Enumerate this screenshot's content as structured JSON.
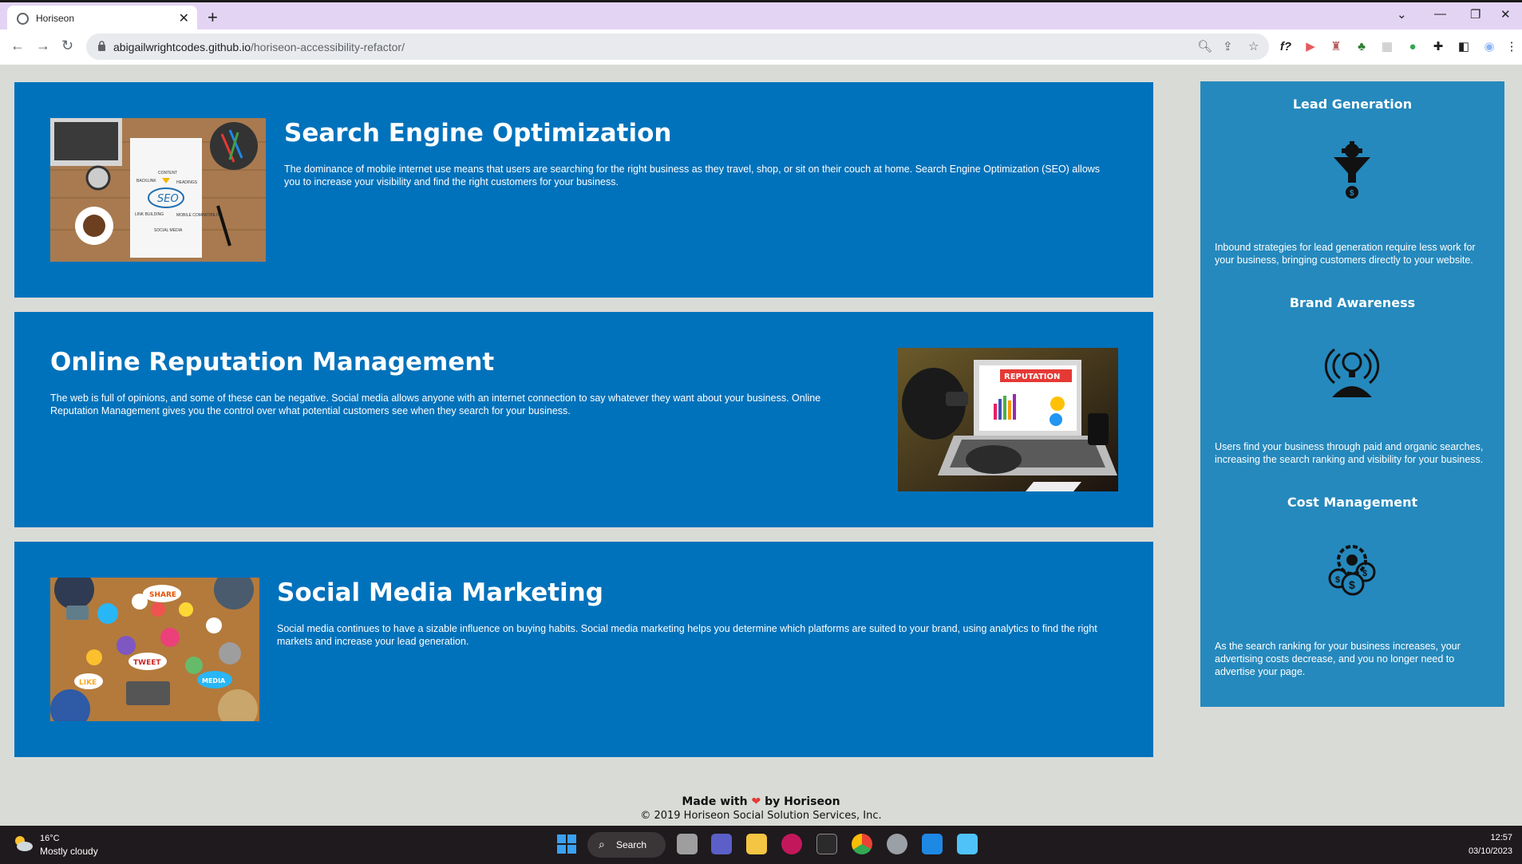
{
  "browser": {
    "tab_title": "Horiseon",
    "url_host": "abigailwrightcodes.github.io",
    "url_path": "/horiseon-accessibility-refactor/"
  },
  "services": [
    {
      "title": "Search Engine Optimization",
      "text": "The dominance of mobile internet use means that users are searching for the right business as they travel, shop, or sit on their couch at home. Search Engine Optimization (SEO) allows you to increase your visibility and find the right customers for your business."
    },
    {
      "title": "Online Reputation Management",
      "text": "The web is full of opinions, and some of these can be negative. Social media allows anyone with an internet connection to say whatever they want about your business. Online Reputation Management gives you the control over what potential customers see when they search for your business."
    },
    {
      "title": "Social Media Marketing",
      "text": "Social media continues to have a sizable influence on buying habits. Social media marketing helps you determine which platforms are suited to your brand, using analytics to find the right markets and increase your lead generation."
    }
  ],
  "seo_image_labels": {
    "seo": "SEO",
    "content": "CONTENT",
    "backlink": "BACKLINK",
    "headings": "HEADINGS",
    "link_building": "LINK BUILDING",
    "mobile": "MOBILE COMPATIBILITY",
    "social": "SOCIAL MEDIA"
  },
  "reputation_image_label": "REPUTATION",
  "social_image_labels": {
    "share": "SHARE",
    "tweet": "TWEET",
    "like": "LIKE",
    "media": "MEDIA"
  },
  "benefits": [
    {
      "title": "Lead Generation",
      "text": "Inbound strategies for lead generation require less work for your business, bringing customers directly to your website."
    },
    {
      "title": "Brand Awareness",
      "text": "Users find your business through paid and organic searches, increasing the search ranking and visibility for your business."
    },
    {
      "title": "Cost Management",
      "text": "As the search ranking for your business increases, your advertising costs decrease, and you no longer need to advertise your page."
    }
  ],
  "footer": {
    "made_prefix": "Made with",
    "heart": "❤",
    "made_suffix": "by Horiseon",
    "copyright": "© 2019 Horiseon Social Solution Services, Inc."
  },
  "taskbar": {
    "temperature": "16°C",
    "weather": "Mostly cloudy",
    "search_label": "Search",
    "time": "12:57",
    "date": "03/10/2023"
  },
  "colors": {
    "card_blue": "#0072bb",
    "sidebar_blue": "#2589bd",
    "page_bg": "#d9dbd7"
  }
}
